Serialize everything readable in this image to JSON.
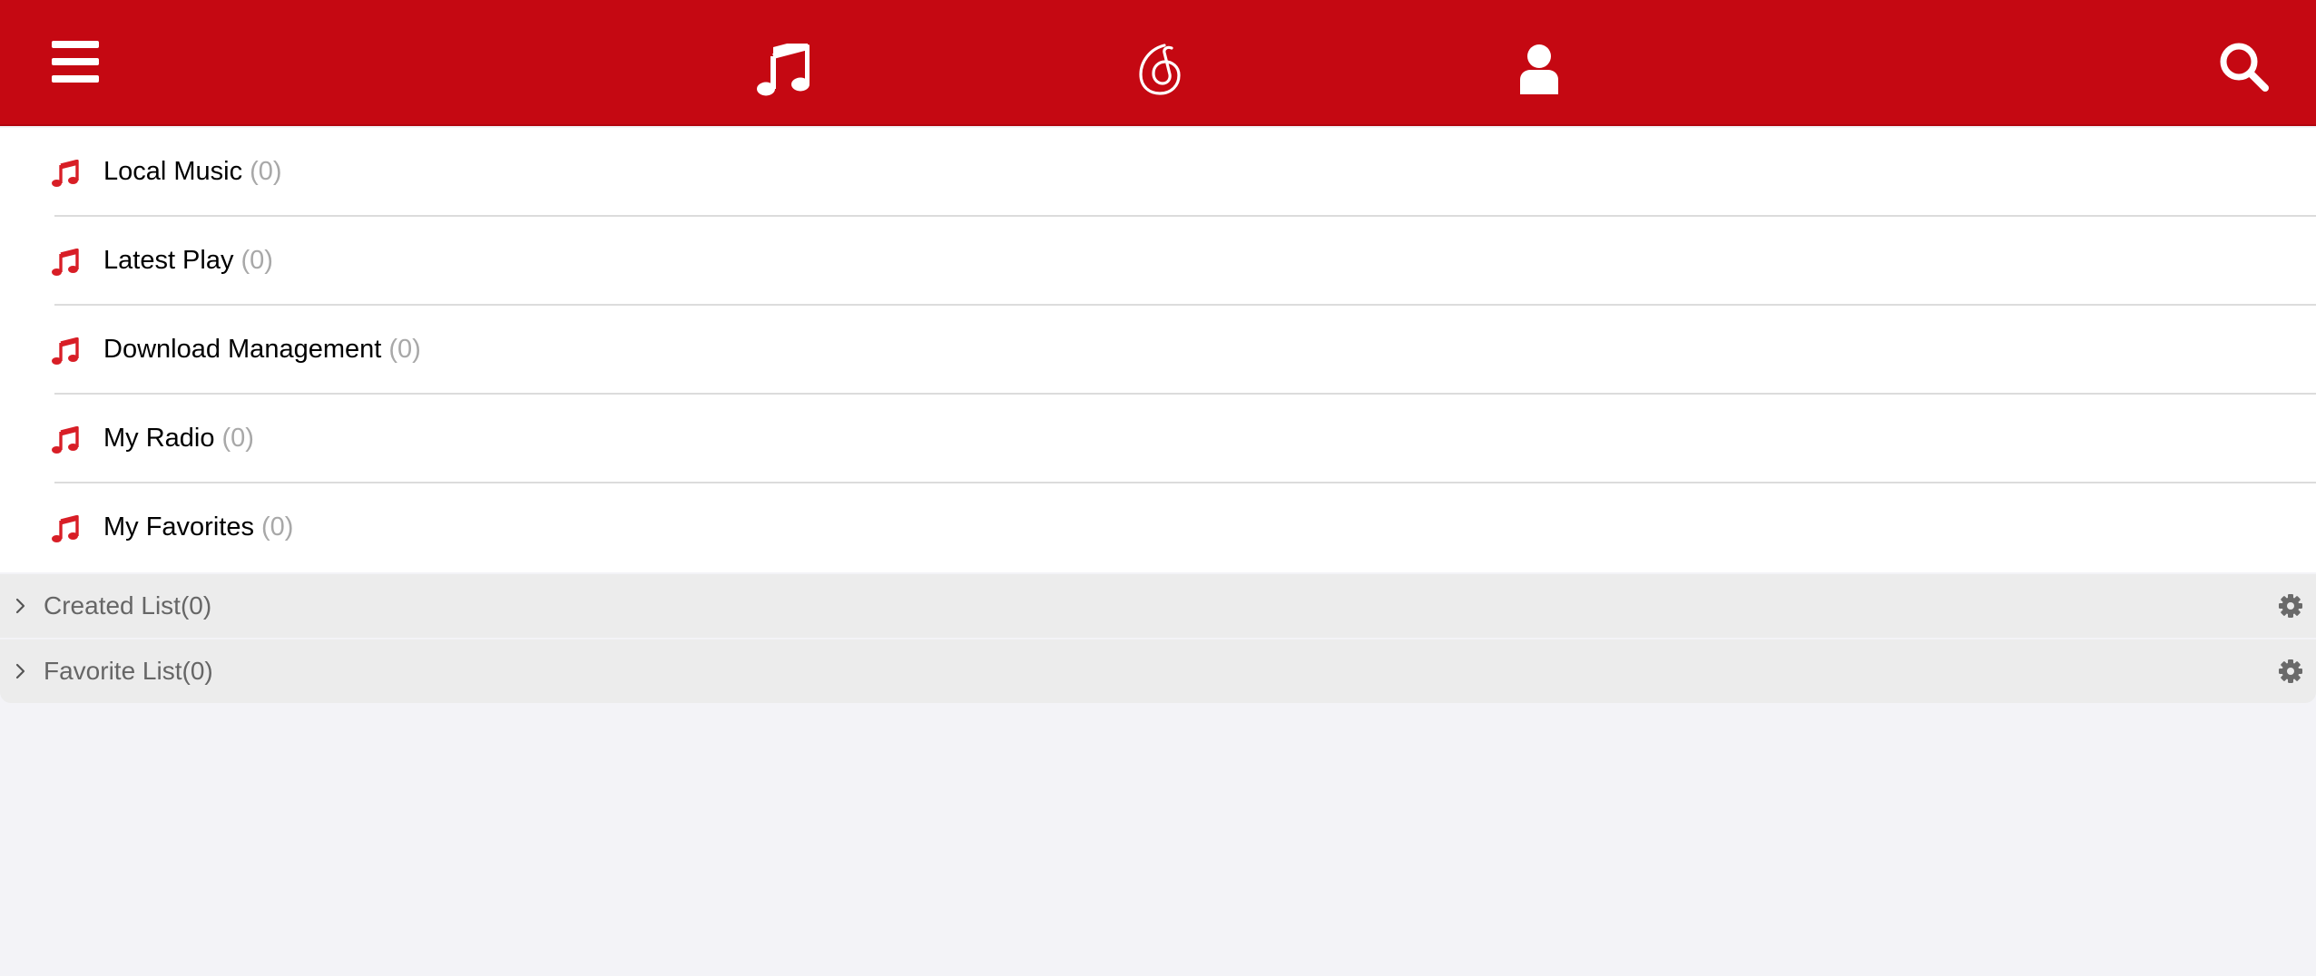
{
  "colors": {
    "brand_red": "#c50812",
    "note_red": "#d81e26",
    "page_bg": "#f3f3f7",
    "section_bg": "#ececec"
  },
  "topbar": {
    "icons": [
      "menu-icon",
      "music-note-icon",
      "netease-logo-icon",
      "user-icon",
      "search-icon"
    ]
  },
  "library": {
    "items": [
      {
        "label": "Local Music",
        "count": "(0)",
        "icon": "music-note-icon"
      },
      {
        "label": "Latest Play",
        "count": "(0)",
        "icon": "music-note-icon"
      },
      {
        "label": "Download Management",
        "count": "(0)",
        "icon": "music-note-icon"
      },
      {
        "label": "My Radio",
        "count": "(0)",
        "icon": "music-note-icon"
      },
      {
        "label": "My Favorites",
        "count": "(0)",
        "icon": "music-note-icon"
      }
    ]
  },
  "sections": {
    "created": {
      "label": "Created List(0)",
      "icon": "gear-icon"
    },
    "favorite": {
      "label": "Favorite List(0)",
      "icon": "gear-icon"
    }
  }
}
